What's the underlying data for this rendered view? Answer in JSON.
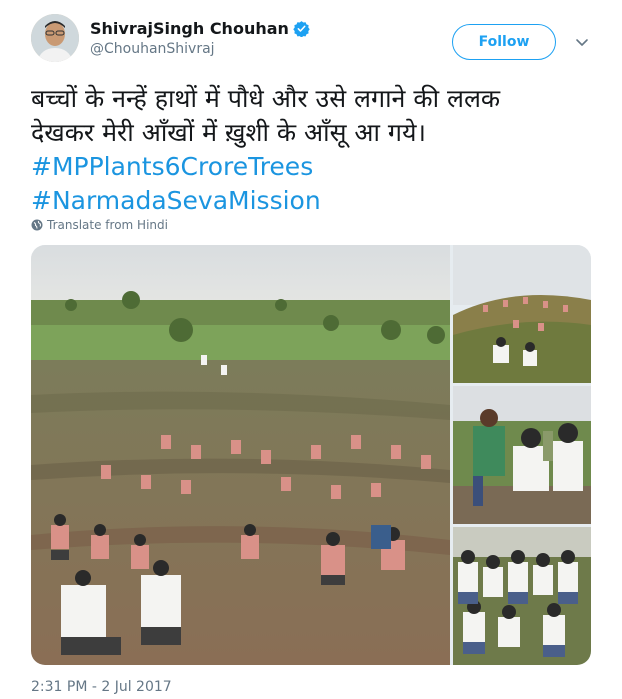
{
  "author": {
    "name": "ShivrajSingh Chouhan",
    "handle": "@ChouhanShivraj",
    "verified": true
  },
  "follow_label": "Follow",
  "tweet": {
    "line1": "बच्चों के नन्हें हाथों में पौधे और उसे लगाने की ललक",
    "line2": "देखकर मेरी आँखों में ख़ुशी के आँसू आ गये।",
    "hashtag1": "#MPPlants6CroreTrees",
    "hashtag2": "#NarmadaSevaMission"
  },
  "translate_label": "Translate from Hindi",
  "timestamp": "2:31 PM - 2 Jul 2017",
  "colors": {
    "accent": "#1da1f2",
    "hashtag": "#1b95e0",
    "secondary_text": "#657786"
  },
  "icons": [
    "verified-icon",
    "chevron-down-icon",
    "globe-icon"
  ]
}
